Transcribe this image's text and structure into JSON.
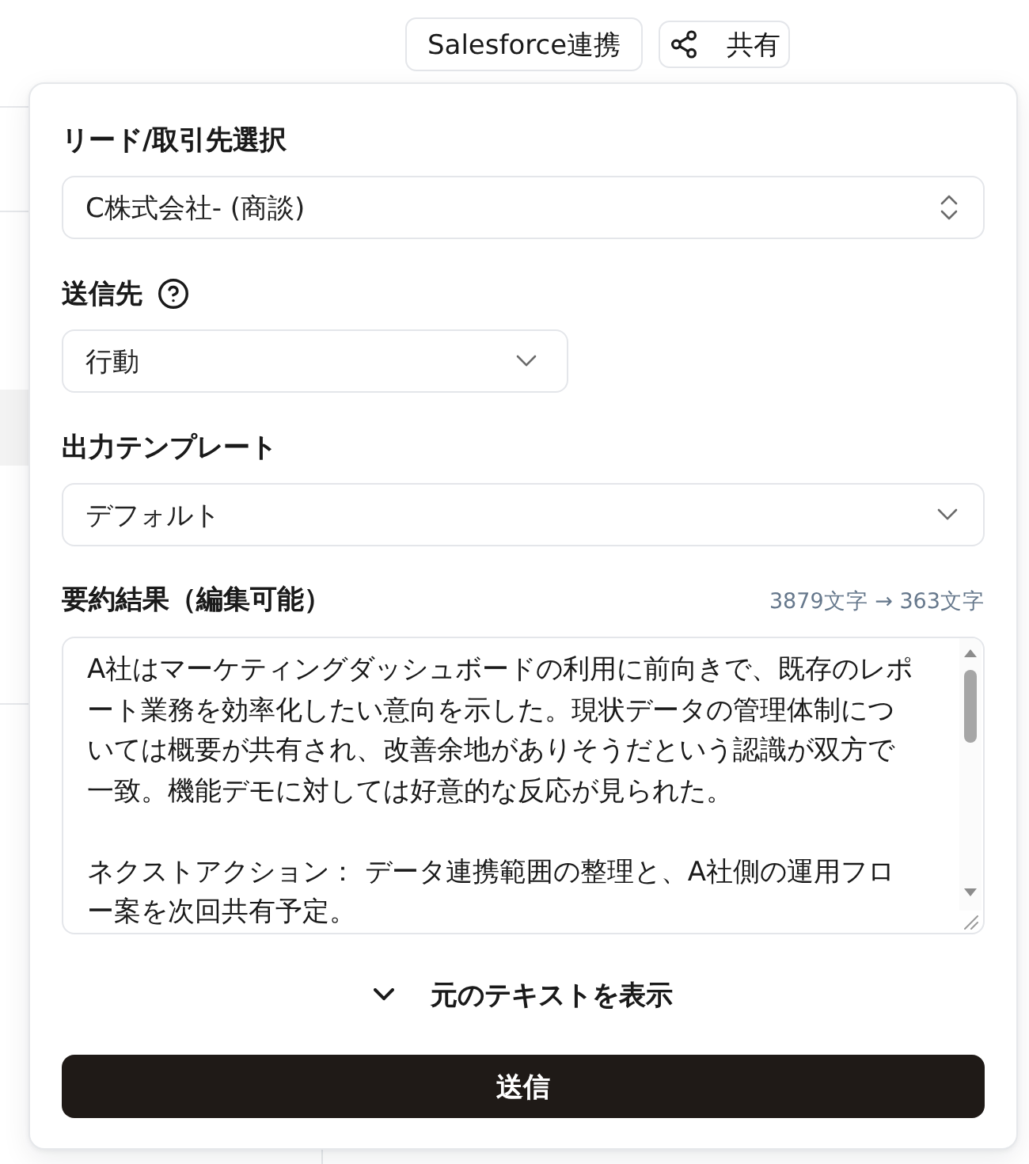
{
  "header": {
    "buttons": [
      {
        "kind": "text",
        "label": "Salesforce連携"
      },
      {
        "kind": "share",
        "label": "共有"
      }
    ]
  },
  "panel": {
    "fields": [
      {
        "kind": "combobox",
        "label": "リード/取引先選択",
        "value": "C株式会社- (商談)",
        "help": false
      },
      {
        "kind": "dropdown",
        "label": "送信先",
        "value": "行動",
        "help": true
      },
      {
        "kind": "dropdown",
        "label": "出力テンプレート",
        "value": "デフォルト",
        "help": false
      }
    ],
    "summary": {
      "label": "要約結果（編集可能）",
      "count": "3879文字 → 363文字",
      "paragraphs": [
        "A社はマーケティングダッシュボードの利用に前向きで、既存のレポート業務を効率化したい意向を示した。現状データの管理体制については概要が共有され、改善余地がありそうだという認識が双方で一致。機能デモに対しては好意的な反応が見られた。",
        "ネクストアクション： データ連携範囲の整理と、A社側の運用フロー案を次回共有予定。"
      ]
    },
    "toggle": {
      "label": "元のテキストを表示",
      "expanded": false
    },
    "submit": {
      "label": "送信"
    }
  }
}
